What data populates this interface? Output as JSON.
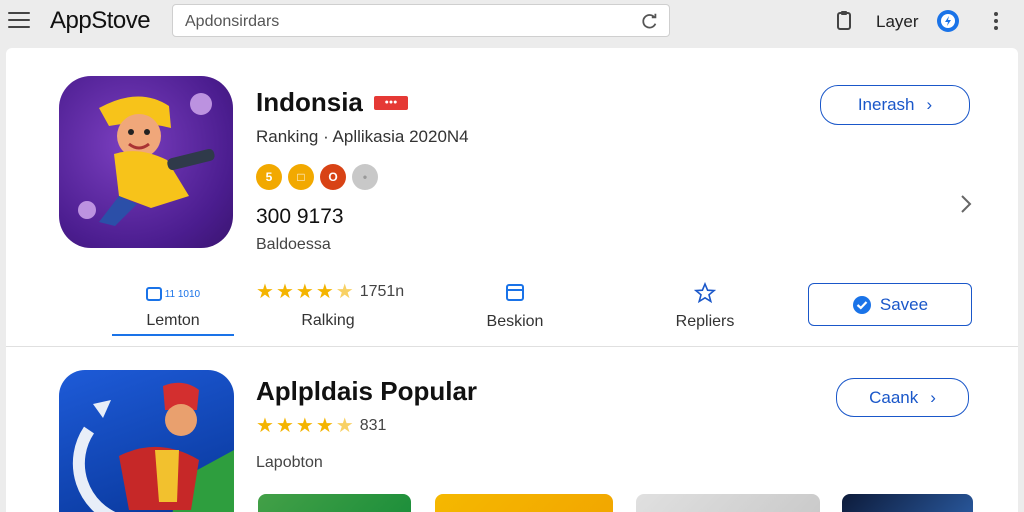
{
  "header": {
    "brand": "AppStove",
    "search_value": "Apdonsirdars",
    "layer_label": "Layer"
  },
  "featured": {
    "title": "Indonsia",
    "subtitle": "Ranking · Apllikasia 2020N4",
    "chips": [
      {
        "label": "5",
        "color": "#f2a900"
      },
      {
        "label": "□",
        "color": "#f2a900"
      },
      {
        "label": "O",
        "color": "#d84315"
      },
      {
        "label": "•",
        "color": "#c8c8c8"
      }
    ],
    "count": "300 9173",
    "developer": "Baldoessa",
    "install_label": "Inerash",
    "rating_count": "1751n",
    "rating_value": 4.5,
    "tabs": [
      {
        "label": "Lemton",
        "badge": "11 1010"
      },
      {
        "label": "Ralking"
      },
      {
        "label": "Beskion"
      },
      {
        "label": "Repliers"
      }
    ],
    "save_label": "Savee"
  },
  "popular": {
    "title": "Aplpldais Popular",
    "rating_count": "831",
    "rating_value": 4.5,
    "developer": "Lapobton",
    "button_label": "Caank"
  },
  "colors": {
    "accent": "#1a57c9",
    "star": "#f4b400",
    "badge_red": "#e53935"
  }
}
